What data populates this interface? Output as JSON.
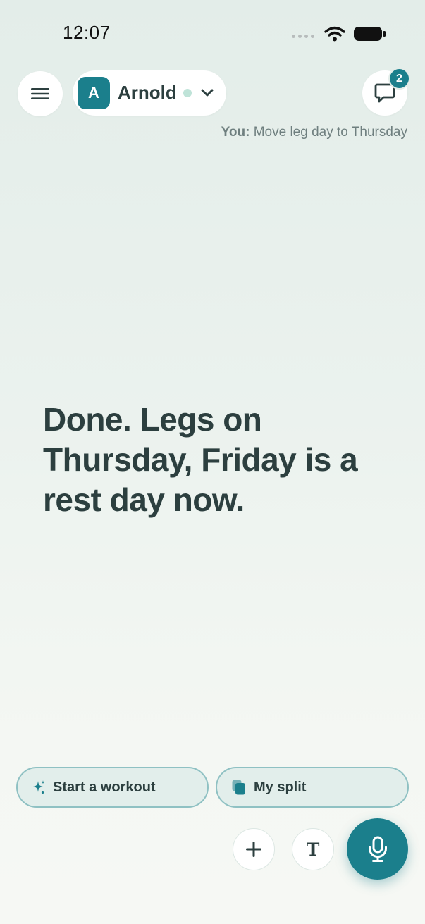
{
  "status_bar": {
    "time": "12:07",
    "icons": [
      "signal-dots-icon",
      "wifi-icon",
      "battery-icon"
    ]
  },
  "header": {
    "menu_icon": "hamburger-menu-icon",
    "profile": {
      "avatar_initial": "A",
      "name": "Arnold",
      "online": true
    },
    "chat": {
      "icon": "chat-bubble-icon",
      "badge_count": "2"
    }
  },
  "last_message": {
    "sender": "You:",
    "text": "Move leg day to Thursday"
  },
  "reply": {
    "text": "Done. Legs on Thursday, Friday is a rest day now."
  },
  "actions": {
    "chips": [
      {
        "label": "Start a workout",
        "icon": "sparkle-icon"
      },
      {
        "label": "My split",
        "icon": "copy-pages-icon"
      }
    ],
    "plus_icon": "plus-icon",
    "text_button_glyph": "T",
    "mic_icon": "microphone-icon"
  },
  "colors": {
    "accent": "#1b7f8c",
    "text": "#2c3f3f",
    "chip_border": "#8fc1c3",
    "chip_fill": "#e2eeeb",
    "online_dot": "#bfe3d8"
  }
}
